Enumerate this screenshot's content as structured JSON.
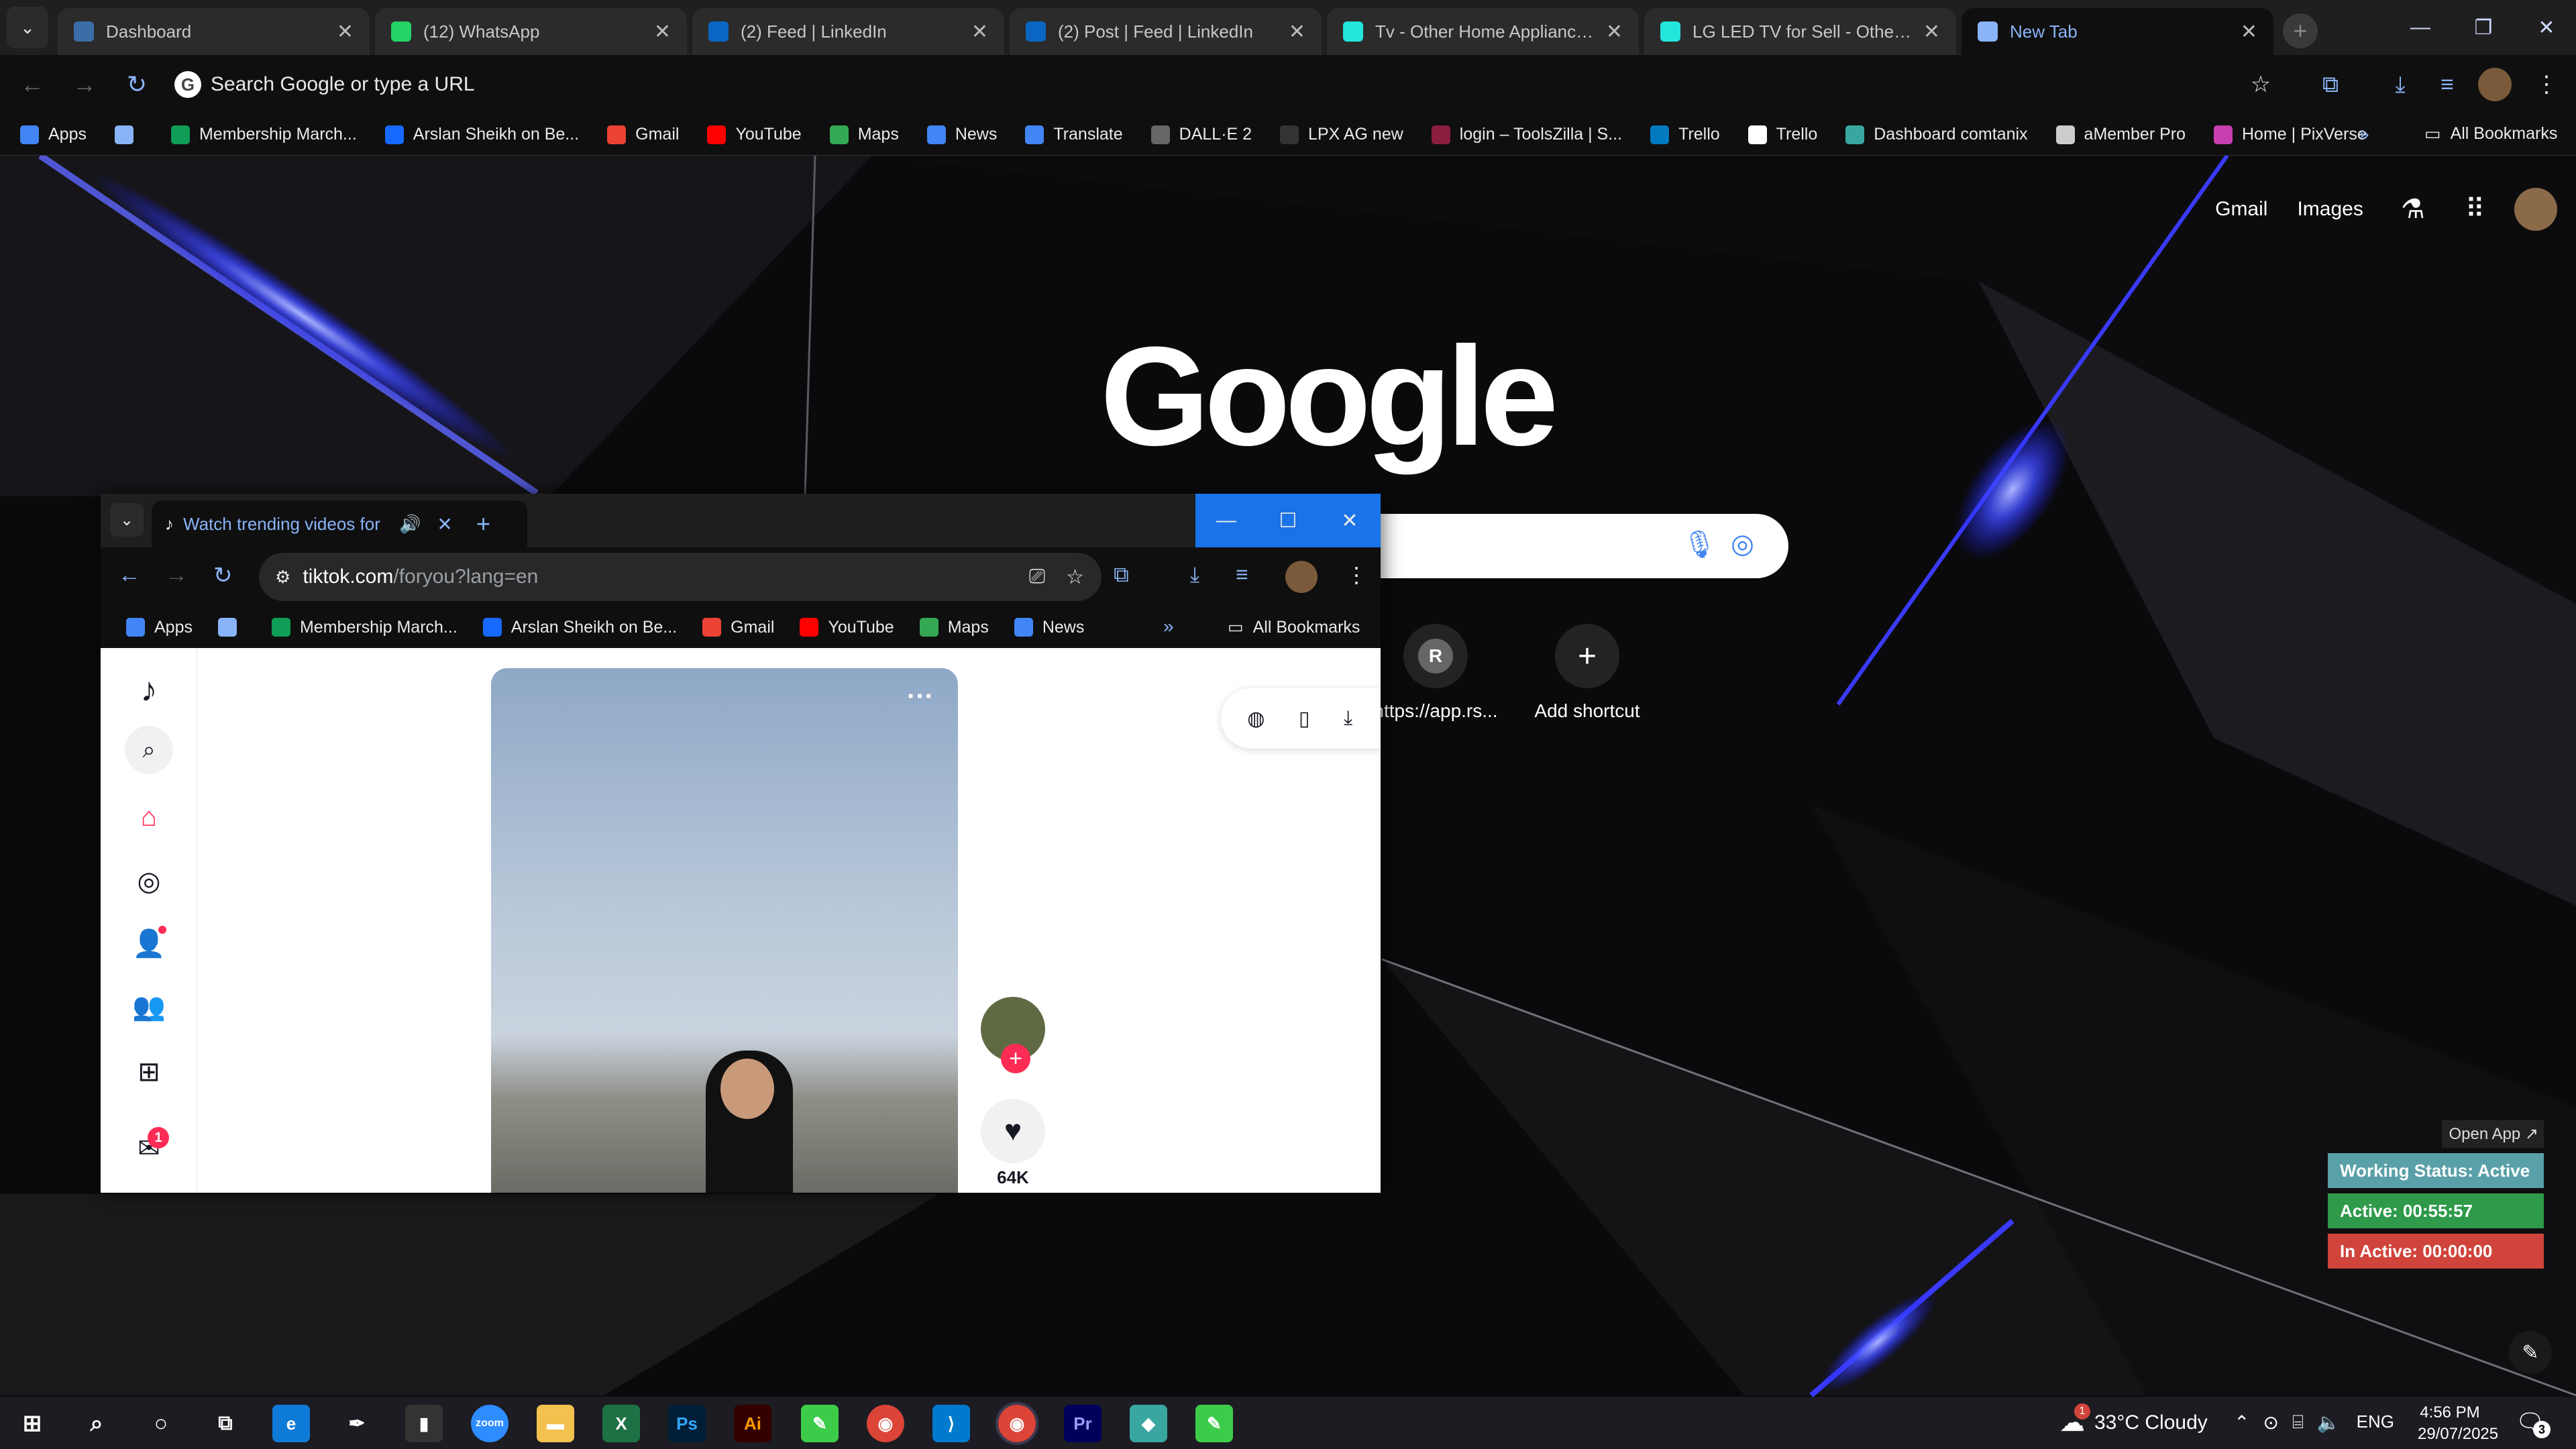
{
  "main_tabs": [
    {
      "title": "Dashboard",
      "icon": "dashboard-icon",
      "color": "#3b6ea8"
    },
    {
      "title": "(12) WhatsApp",
      "icon": "whatsapp-icon",
      "color": "#25d366"
    },
    {
      "title": "(2) Feed | LinkedIn",
      "icon": "linkedin-icon",
      "color": "#0a66c2"
    },
    {
      "title": "(2) Post | Feed | LinkedIn",
      "icon": "linkedin-icon",
      "color": "#0a66c2"
    },
    {
      "title": "Tv - Other Home Appliances fo",
      "icon": "olx-icon",
      "color": "#23e5db"
    },
    {
      "title": "LG LED TV for Sell - Other Hon",
      "icon": "olx-icon",
      "color": "#23e5db"
    },
    {
      "title": "New Tab",
      "icon": "chrome-icon",
      "color": "#8ab4f8"
    }
  ],
  "omnibox": {
    "placeholder": "Search Google or type a URL"
  },
  "bookmarks": [
    {
      "label": "Apps",
      "icon": "apps-grid-icon",
      "color": "#4285f4"
    },
    {
      "label": "",
      "icon": "tab-groups-icon",
      "color": "#8ab4f8"
    },
    {
      "label": "Membership March...",
      "icon": "sheets-icon",
      "color": "#0f9d58"
    },
    {
      "label": "Arslan Sheikh on Be...",
      "icon": "behance-icon",
      "color": "#1769ff"
    },
    {
      "label": "Gmail",
      "icon": "gmail-icon",
      "color": "#ea4335"
    },
    {
      "label": "YouTube",
      "icon": "youtube-icon",
      "color": "#ff0000"
    },
    {
      "label": "Maps",
      "icon": "maps-icon",
      "color": "#34a853"
    },
    {
      "label": "News",
      "icon": "news-icon",
      "color": "#4285f4"
    },
    {
      "label": "Translate",
      "icon": "translate-icon",
      "color": "#4285f4"
    },
    {
      "label": "DALL·E 2",
      "icon": "openai-icon",
      "color": "#666666"
    },
    {
      "label": "LPX AG new",
      "icon": "lpx-icon",
      "color": "#333333"
    },
    {
      "label": "login – ToolsZilla | S...",
      "icon": "toolszilla-icon",
      "color": "#8b1e3f"
    },
    {
      "label": "Trello",
      "icon": "trello-icon",
      "color": "#0079bf"
    },
    {
      "label": "Trello",
      "icon": "trello-icon",
      "color": "#ffffff"
    },
    {
      "label": "Dashboard comtanix",
      "icon": "comtanix-icon",
      "color": "#3aa6a0"
    },
    {
      "label": "aMember Pro",
      "icon": "amember-icon",
      "color": "#cccccc"
    },
    {
      "label": "Home | PixVerse",
      "icon": "pixverse-icon",
      "color": "#c73fb1"
    }
  ],
  "all_bookmarks": "All Bookmarks",
  "ntp": {
    "gmail": "Gmail",
    "images": "Images",
    "logo": "Google",
    "shortcuts": [
      {
        "label": "https://app.rs...",
        "letter": "R"
      },
      {
        "label": "Add shortcut",
        "letter": "+"
      }
    ]
  },
  "popup": {
    "tab_title": "Watch trending videos for y",
    "url_domain": "tiktok.com",
    "url_path": "/foryou?lang=en",
    "bookmarks": [
      {
        "label": "Apps",
        "color": "#4285f4"
      },
      {
        "label": "",
        "color": "#8ab4f8"
      },
      {
        "label": "Membership March...",
        "color": "#0f9d58"
      },
      {
        "label": "Arslan Sheikh on Be...",
        "color": "#1769ff"
      },
      {
        "label": "Gmail",
        "color": "#ea4335"
      },
      {
        "label": "YouTube",
        "color": "#ff0000"
      },
      {
        "label": "Maps",
        "color": "#34a853"
      },
      {
        "label": "News",
        "color": "#4285f4"
      }
    ],
    "all_bookmarks": "All Bookmarks",
    "notification_count": "1",
    "likes": "64K",
    "more": "···"
  },
  "status": {
    "open_app": "Open App ↗",
    "working": "Working Status: Active",
    "active": "Active: 00:55:57",
    "inactive": "In Active: 00:00:00",
    "colors": {
      "working": "#5aa0a8",
      "active": "#2e9a4a",
      "inactive": "#d0443c"
    }
  },
  "taskbar": {
    "weather": "33°C  Cloudy",
    "lang": "ENG",
    "time": "4:56 PM",
    "date": "29/07/2025",
    "notifications": "3",
    "weather_badge": "1"
  }
}
